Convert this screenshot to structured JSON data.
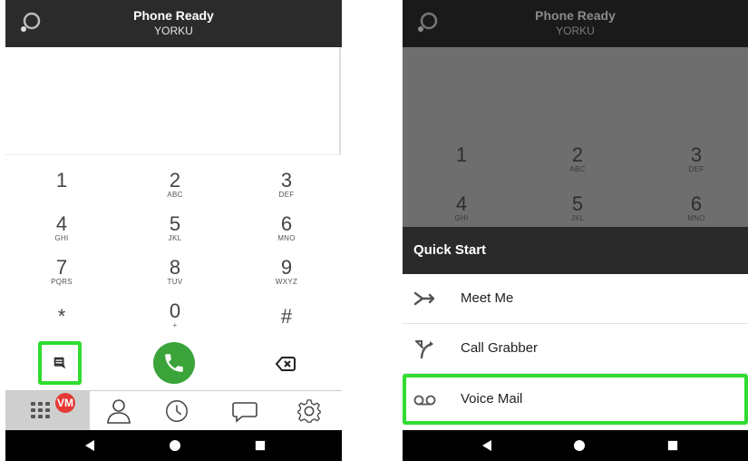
{
  "left_screen": {
    "status_title": "Phone Ready",
    "status_subtitle": "YORKU",
    "keypad": [
      {
        "digit": "1",
        "letters": ""
      },
      {
        "digit": "2",
        "letters": "ABC"
      },
      {
        "digit": "3",
        "letters": "DEF"
      },
      {
        "digit": "4",
        "letters": "GHI"
      },
      {
        "digit": "5",
        "letters": "JKL"
      },
      {
        "digit": "6",
        "letters": "MNO"
      },
      {
        "digit": "7",
        "letters": "PQRS"
      },
      {
        "digit": "8",
        "letters": "TUV"
      },
      {
        "digit": "9",
        "letters": "WXYZ"
      },
      {
        "digit": "*",
        "letters": ""
      },
      {
        "digit": "0",
        "letters": "+"
      },
      {
        "digit": "#",
        "letters": ""
      }
    ],
    "vm_badge": "VM",
    "tabs": [
      "dialpad-icon",
      "contacts-icon",
      "history-icon",
      "messages-icon",
      "settings-icon"
    ]
  },
  "right_screen": {
    "status_title": "Phone Ready",
    "status_subtitle": "YORKU",
    "keypad_visible": [
      {
        "digit": "1",
        "letters": ""
      },
      {
        "digit": "2",
        "letters": "ABC"
      },
      {
        "digit": "3",
        "letters": "DEF"
      },
      {
        "digit": "4",
        "letters": "GHI"
      },
      {
        "digit": "5",
        "letters": "JKL"
      },
      {
        "digit": "6",
        "letters": "MNO"
      }
    ],
    "quick_start_title": "Quick Start",
    "items": [
      {
        "label": "Meet Me",
        "icon": "meet-me-icon"
      },
      {
        "label": "Call Grabber",
        "icon": "call-grabber-icon"
      },
      {
        "label": "Voice Mail",
        "icon": "voicemail-icon"
      }
    ]
  },
  "colors": {
    "highlight": "#2fdc2f",
    "call_green": "#3aa43a",
    "badge_red": "#e53935"
  }
}
